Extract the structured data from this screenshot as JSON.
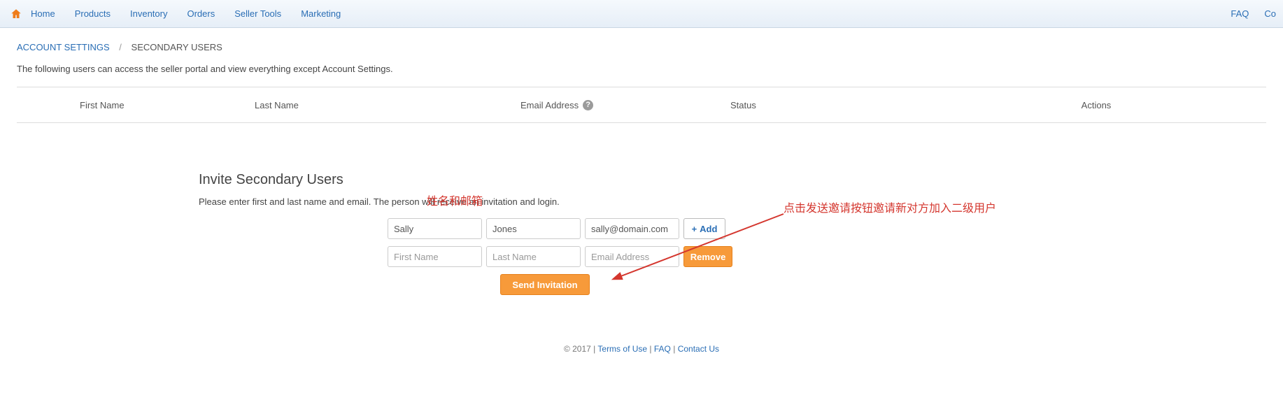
{
  "nav": {
    "items": [
      "Home",
      "Products",
      "Inventory",
      "Orders",
      "Seller Tools",
      "Marketing"
    ],
    "right": [
      "FAQ",
      "Co"
    ]
  },
  "breadcrumb": {
    "link": "ACCOUNT SETTINGS",
    "sep": "/",
    "current": "SECONDARY USERS"
  },
  "description": "The following users can access the seller portal and view everything except Account Settings.",
  "table": {
    "headers": {
      "first": "First Name",
      "last": "Last Name",
      "email": "Email Address",
      "status": "Status",
      "actions": "Actions"
    }
  },
  "invite": {
    "title": "Invite Secondary Users",
    "desc": "Please enter first and last name and email. The person will receive an invitation and login.",
    "rows": [
      {
        "first": "Sally",
        "last": "Jones",
        "email": "sally@domain.com",
        "action": "add"
      },
      {
        "first": "",
        "last": "",
        "email": "",
        "action": "remove"
      }
    ],
    "placeholders": {
      "first": "First Name",
      "last": "Last Name",
      "email": "Email Address"
    },
    "add_label": "Add",
    "remove_label": "Remove",
    "send_label": "Send Invitation"
  },
  "annotations": {
    "a1": "姓名和邮箱",
    "a2": "点击发送邀请按钮邀请新对方加入二级用户"
  },
  "footer": {
    "copyright": "© 2017",
    "sep": " | ",
    "terms": "Terms of Use",
    "faq": "FAQ",
    "contact": "Contact Us"
  }
}
